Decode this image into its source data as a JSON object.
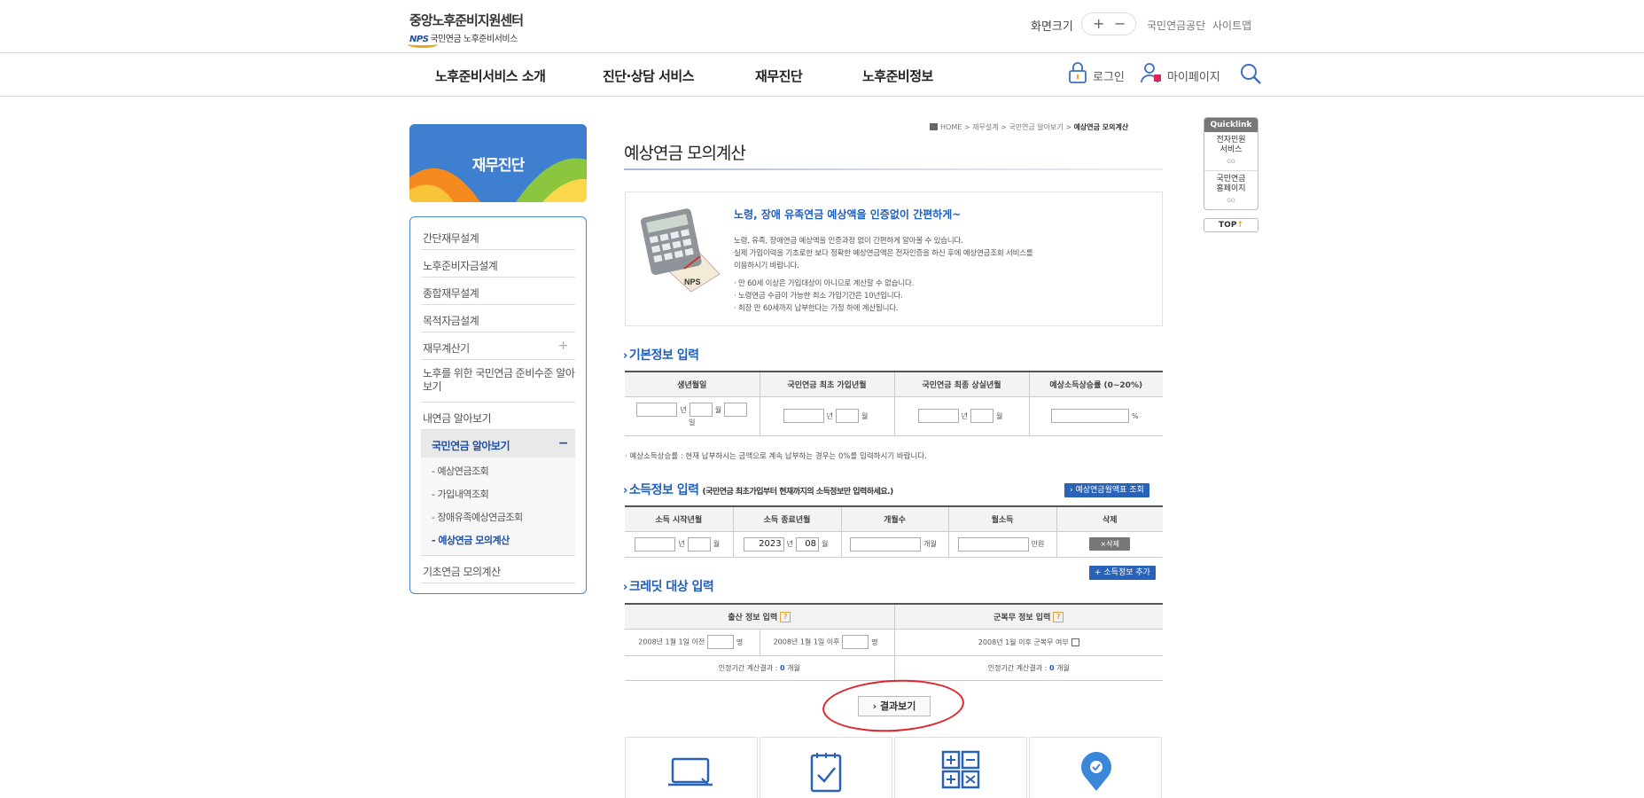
{
  "header": {
    "logo_title": "중앙노후준비지원센터",
    "logo_nps": "NPS",
    "logo_sub": "국민연금 노후준비서비스",
    "zoom_label": "화면크기",
    "zoom_plus": "+",
    "zoom_minus": "−",
    "links": [
      "국민연금공단",
      "사이트맵"
    ]
  },
  "gnb": {
    "menus": [
      "노후준비서비스 소개",
      "진단·상담 서비스",
      "재무진단",
      "노후준비정보"
    ],
    "login": "로그인",
    "mypage": "마이페이지"
  },
  "lnb": {
    "title": "재무진단",
    "items": [
      "간단재무설계",
      "노후준비자금설계",
      "종합재무설계",
      "목적자금설계",
      "재무계산기",
      "노후를 위한 국민연금 준비수준 알아보기",
      "내연금 알아보기",
      "국민연금 알아보기",
      "기초연금 모의계산"
    ],
    "plus": "+",
    "minus": "−",
    "sub_items": [
      "- 예상연금조회",
      "- 가입내역조회",
      "- 장애유족예상연금조회",
      "- 예상연금 모의계산"
    ]
  },
  "quicklink": {
    "title": "Quicklink",
    "items": [
      "전자민원 서비스",
      "국민연금 홈페이지"
    ],
    "go": "GO",
    "top": "TOP"
  },
  "breadcrumb": {
    "home": "HOME",
    "sep": ">",
    "path": [
      "재무설계",
      "국민연금 알아보기"
    ],
    "current": "예상연금 모의계산"
  },
  "page_title": "예상연금 모의계산",
  "intro": {
    "heading": "노령, 장애 유족연금 예상액을 인증없이 간편하게~",
    "p1": [
      "노령, 유족, 장애연금 예상액을 인증과정 없이 간편하게 알아볼 수 있습니다.",
      "실제 가입이력을 기초로한 보다 정확한 예상연금액은 전자인증을 하신 후에 예상연금조회 서비스를",
      "이용하시기 바랍니다."
    ],
    "p2": [
      "· 만 60세 이상은 가입대상이 아니므로 계산할 수 없습니다.",
      "· 노령연금 수급이 가능한 최소 가입기간은 10년입니다.",
      "· 최장 만 60세까지 납부한다는 가정 하에 계산됩니다."
    ],
    "image_label": "NPS"
  },
  "basic": {
    "title": "기본정보 입력",
    "headers": [
      "생년월일",
      "국민연금 최초 가입년월",
      "국민연금 최종 상실년월",
      "예상소득상승률 (0~20%)"
    ],
    "unit_year": "년",
    "unit_month": "월",
    "unit_day": "일",
    "unit_percent": "%",
    "note": "· 예상소득상승률 : 현재 납부하시는 금액으로 계속 납부하는 경우는 0%를 입력하시기 바랍니다."
  },
  "income": {
    "title": "소득정보 입력",
    "subtitle": "(국민연금 최초가입부터 현재까지의 소득정보만 입력하세요.)",
    "table_button": "예상연금월액표 조회",
    "headers": [
      "소득 시작년월",
      "소득 종료년월",
      "개월수",
      "월소득",
      "삭제"
    ],
    "end_year": "2023",
    "end_month": "08",
    "unit_months": "개월",
    "unit_manwon": "만원",
    "delete_button": "×삭제",
    "add_button": "+ 소득정보 추가"
  },
  "credit": {
    "title": "크레딧 대상 입력",
    "headers": [
      "출산 정보 입력",
      "군복무 정보 입력"
    ],
    "birth_before": "2008년 1월 1일 이전",
    "birth_after": "2008년 1월 1일 이후",
    "unit_person": "명",
    "military": "2008년 1월 이후 군복무 여부",
    "result_label": "인정기간 계산결과 :",
    "result_value": "0",
    "result_unit": "개월"
  },
  "result_button": "결과보기",
  "colors": {
    "accent": "#1e5fbf",
    "annotation": "#e0242b",
    "lnb_title": "#3e7fd0"
  }
}
